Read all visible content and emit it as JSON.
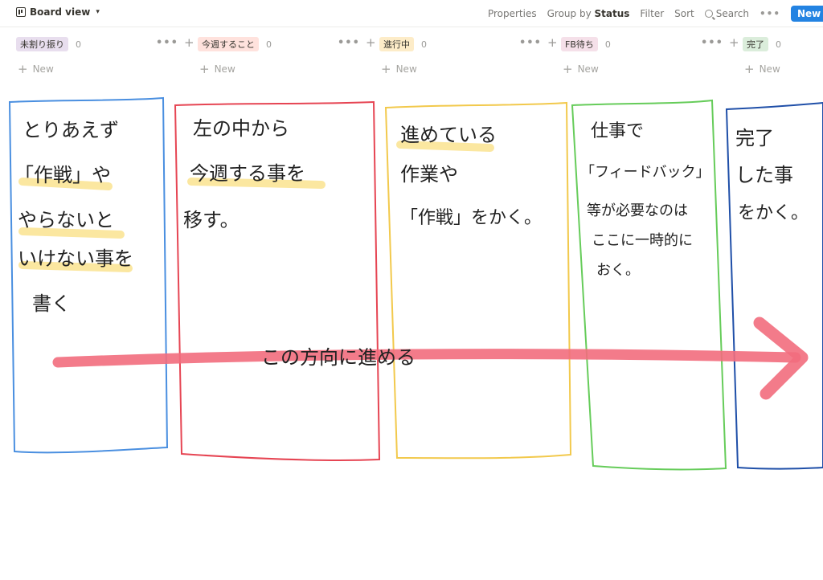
{
  "view": {
    "title": "Board view",
    "chevron": "▾",
    "icon": "board-view-icon"
  },
  "toolbar": {
    "properties": "Properties",
    "group_by_prefix": "Group by",
    "group_by_value": "Status",
    "filter": "Filter",
    "sort": "Sort",
    "search": "Search",
    "more": "•••",
    "new_button": "New"
  },
  "colors": {
    "accent": "#2383e2",
    "tag_purple": "#e8deee",
    "tag_red": "#ffe2dd",
    "tag_yellow": "#fdecc8",
    "tag_pink": "#f5e0e9",
    "tag_green": "#dbeddb"
  },
  "columns": [
    {
      "label": "未割り振り",
      "count": "0",
      "new": "New",
      "more": "•••",
      "plus": "+"
    },
    {
      "label": "今週すること",
      "count": "0",
      "new": "New",
      "more": "•••",
      "plus": "+"
    },
    {
      "label": "進行中",
      "count": "0",
      "new": "New",
      "more": "•••",
      "plus": "+"
    },
    {
      "label": "FB待ち",
      "count": "0",
      "new": "New",
      "more": "•••",
      "plus": "+"
    },
    {
      "label": "完了",
      "count": "0",
      "new": "New"
    }
  ],
  "annotations": {
    "col1": [
      "とりあえず",
      "「作戦」や",
      "やらないと",
      "いけない事を",
      "書く"
    ],
    "col2": [
      "左の中から",
      "今週する事を",
      "移す。"
    ],
    "col3": [
      "進めている",
      "作業や",
      "「作戦」をかく。"
    ],
    "col4": [
      "仕事で",
      "「フィードバック」",
      "等が必要なのは",
      "ここに一時的に",
      "おく。"
    ],
    "col5": [
      "完了",
      "した事",
      "をかく。"
    ],
    "arrow_label": "この方向に進める"
  }
}
